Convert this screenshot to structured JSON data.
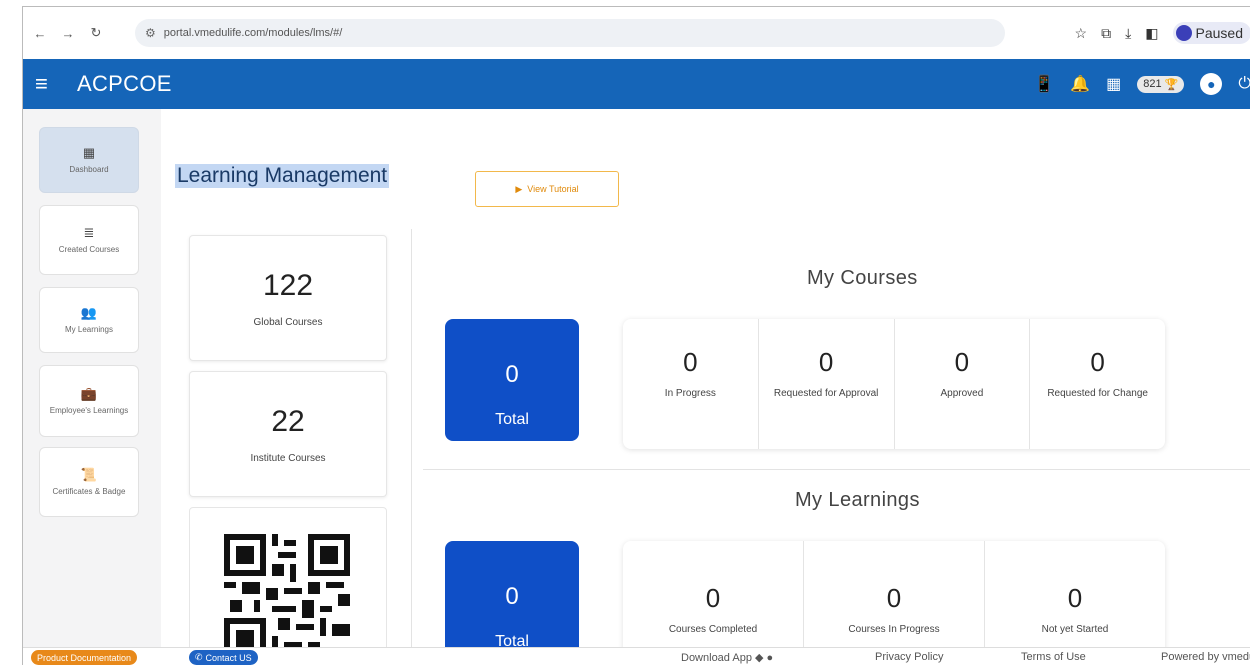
{
  "browser": {
    "url": "portal.vmedulife.com/modules/lms/#/",
    "profile_label": "Paused"
  },
  "header": {
    "brand": "ACPCOE",
    "points": "821"
  },
  "sidebar": {
    "items": [
      {
        "label": "Dashboard",
        "icon": "grid-icon"
      },
      {
        "label": "Created Courses",
        "icon": "layers-icon"
      },
      {
        "label": "My Learnings",
        "icon": "users-icon"
      },
      {
        "label": "Employee's Learnings",
        "icon": "briefcase-icon"
      },
      {
        "label": "Certificates & Badge",
        "icon": "certificate-icon"
      }
    ]
  },
  "main": {
    "title": "Learning Management",
    "tutorial_button": "View Tutorial",
    "stats": [
      {
        "value": "122",
        "label": "Global Courses"
      },
      {
        "value": "22",
        "label": "Institute Courses"
      }
    ],
    "my_courses": {
      "title": "My Courses",
      "total_value": "0",
      "total_label": "Total",
      "metrics": [
        {
          "value": "0",
          "label": "In Progress"
        },
        {
          "value": "0",
          "label": "Requested for Approval"
        },
        {
          "value": "0",
          "label": "Approved"
        },
        {
          "value": "0",
          "label": "Requested for Change"
        }
      ]
    },
    "my_learnings": {
      "title": "My Learnings",
      "total_value": "0",
      "total_label": "Total",
      "metrics": [
        {
          "value": "0",
          "label": "Courses Completed"
        },
        {
          "value": "0",
          "label": "Courses In Progress"
        },
        {
          "value": "0",
          "label": "Not yet Started"
        }
      ]
    }
  },
  "footer": {
    "product_docs": "Product Documentation",
    "contact": "Contact US",
    "download_app": "Download App",
    "privacy": "Privacy Policy",
    "terms": "Terms of Use",
    "powered": "Powered by vmedulife"
  },
  "colors": {
    "header_blue": "#1565b8",
    "tile_blue": "#0f4fc7",
    "accent_orange": "#e8891a"
  }
}
